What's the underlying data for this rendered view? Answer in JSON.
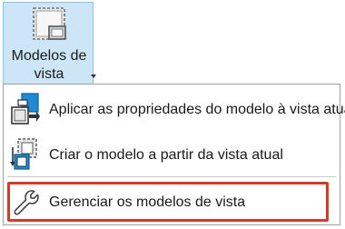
{
  "ribbon": {
    "button": {
      "label_line1": "Modelos de",
      "label_line2": "vista",
      "icon": "view-template-icon",
      "has_dropdown": true
    }
  },
  "menu": {
    "items": [
      {
        "label": "Aplicar as propriedades do modelo à vista atual",
        "icon": "apply-template-icon"
      },
      {
        "label": "Criar o modelo a partir da vista atual",
        "icon": "create-template-icon"
      },
      {
        "label": "Gerenciar os modelos de vista",
        "icon": "wrench-icon",
        "highlighted": true
      }
    ]
  },
  "colors": {
    "ribbon_bg": "#cde6f7",
    "ribbon_border": "#8cc3e8",
    "highlight_border": "#d23a2a",
    "icon_blue": "#1e8ad6"
  }
}
